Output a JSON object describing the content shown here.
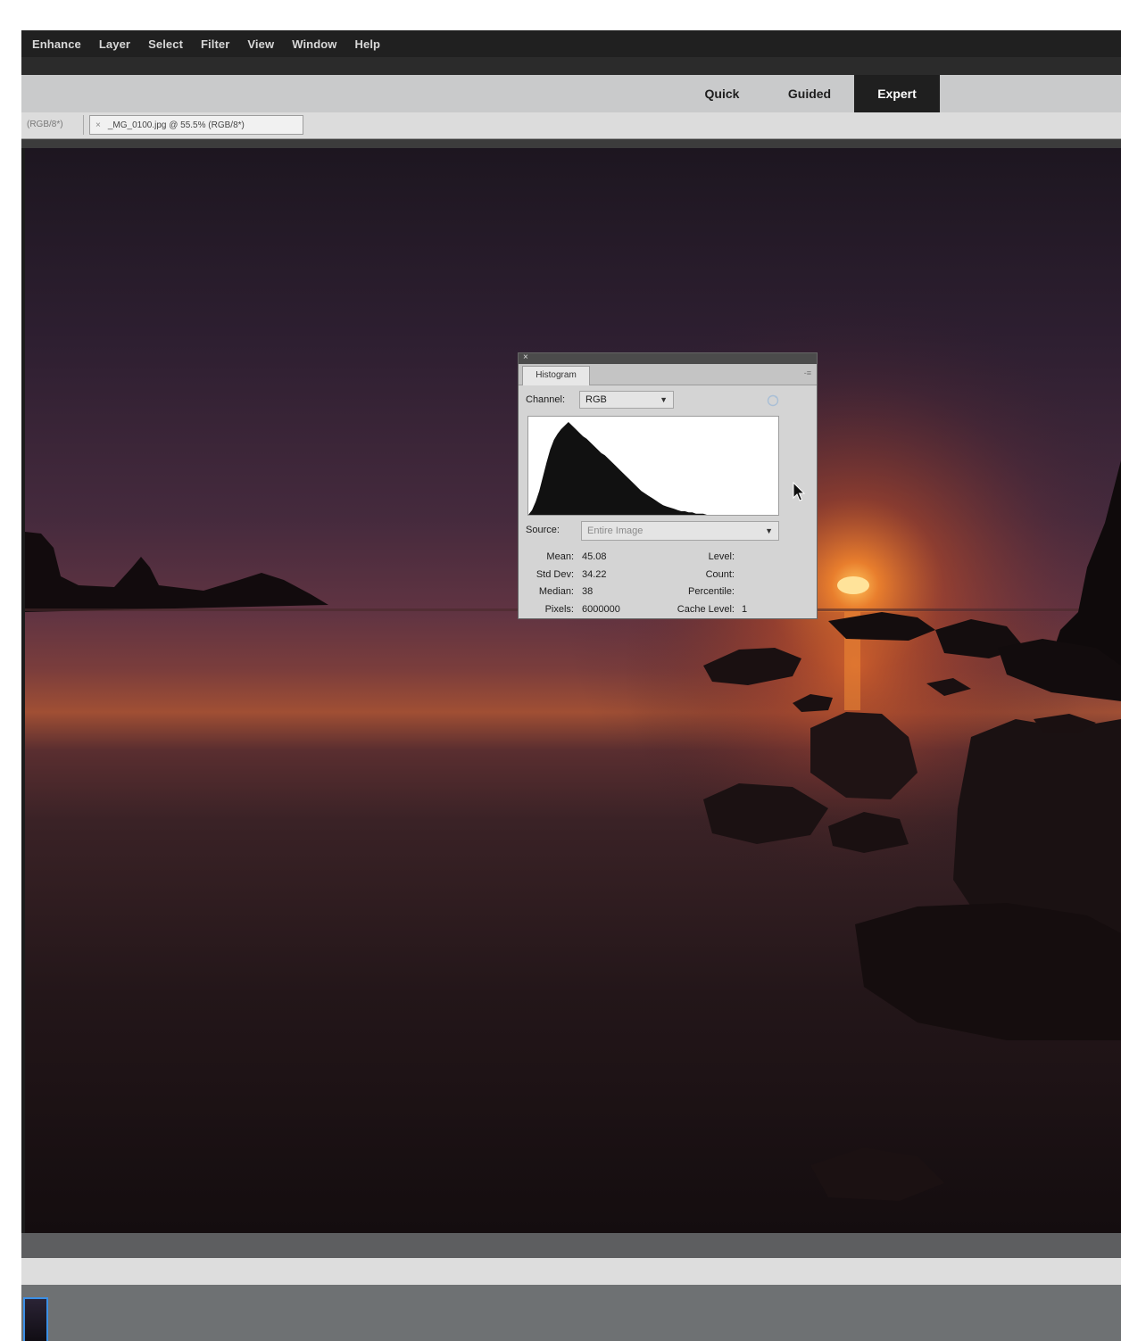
{
  "menu": {
    "items": [
      "Enhance",
      "Layer",
      "Select",
      "Filter",
      "View",
      "Window",
      "Help"
    ]
  },
  "modes": {
    "quick": "Quick",
    "guided": "Guided",
    "expert": "Expert",
    "active": "Expert"
  },
  "document_tabs": {
    "previous_label": "(RGB/8*)",
    "active_close": "×",
    "active_label": "_MG_0100.jpg @ 55.5% (RGB/8*)"
  },
  "histogram_panel": {
    "close_glyph": "×",
    "tab_label": "Histogram",
    "menu_glyph": "-≡",
    "channel_label": "Channel:",
    "channel_value": "RGB",
    "source_label": "Source:",
    "source_value": "Entire Image",
    "stats_left": [
      {
        "label": "Mean:",
        "value": "45.08"
      },
      {
        "label": "Std Dev:",
        "value": "34.22"
      },
      {
        "label": "Median:",
        "value": "38"
      },
      {
        "label": "Pixels:",
        "value": "6000000"
      }
    ],
    "stats_right": [
      {
        "label": "Level:",
        "value": ""
      },
      {
        "label": "Count:",
        "value": ""
      },
      {
        "label": "Percentile:",
        "value": ""
      },
      {
        "label": "Cache Level:",
        "value": "1"
      }
    ],
    "histogram_levels": [
      0,
      4,
      11,
      20,
      32,
      44,
      55,
      63,
      68,
      72,
      75,
      78,
      75,
      72,
      69,
      66,
      64,
      61,
      58,
      55,
      52,
      50,
      47,
      44,
      41,
      38,
      35,
      32,
      29,
      26,
      23,
      20,
      18,
      16,
      14,
      12,
      10,
      8,
      7,
      6,
      5,
      4,
      3,
      3,
      2,
      2,
      1,
      1,
      1,
      0
    ]
  },
  "icons": {
    "caret": "▼",
    "refresh": "refresh-icon",
    "cursor": "arrow-cursor-icon"
  },
  "colors": {
    "expert_tab_bg": "#1f1f1f",
    "menubar_bg": "#202020",
    "modebar_bg": "#c9cacb"
  }
}
